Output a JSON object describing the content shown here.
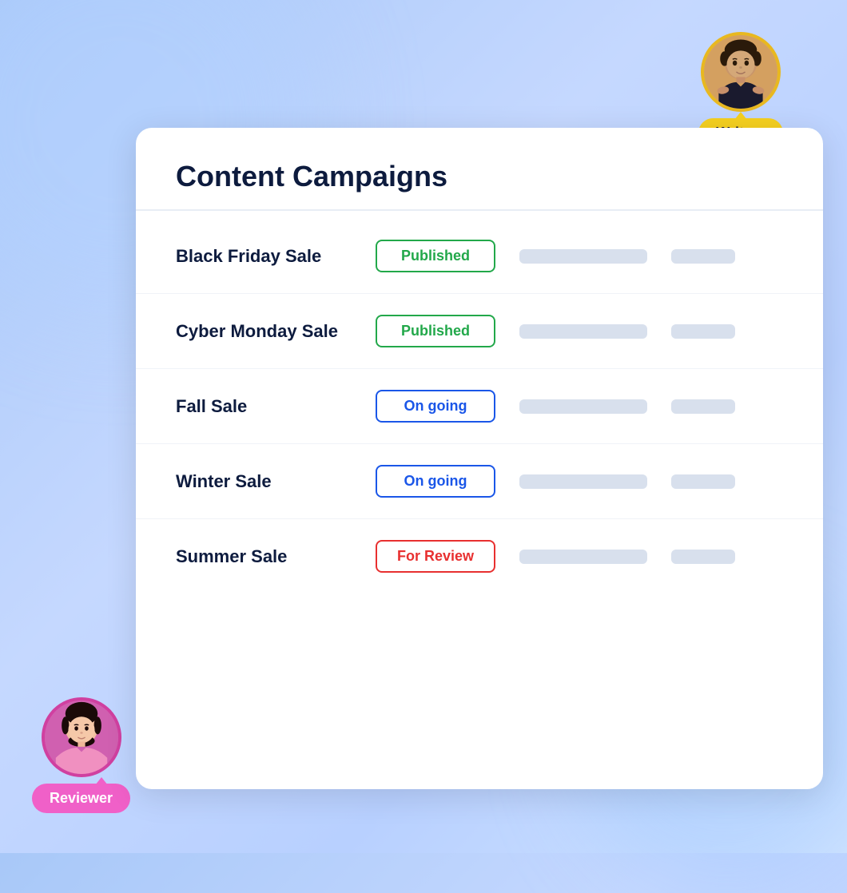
{
  "page": {
    "background": "light blue gradient"
  },
  "writers_badge": {
    "label": "Writers"
  },
  "reviewer_badge": {
    "label": "Reviewer"
  },
  "card": {
    "title": "Content Campaigns",
    "campaigns": [
      {
        "id": 1,
        "name": "Black Friday Sale",
        "status": "Published",
        "status_type": "published"
      },
      {
        "id": 2,
        "name": "Cyber Monday Sale",
        "status": "Published",
        "status_type": "published"
      },
      {
        "id": 3,
        "name": "Fall Sale",
        "status": "On going",
        "status_type": "ongoing"
      },
      {
        "id": 4,
        "name": "Winter Sale",
        "status": "On going",
        "status_type": "ongoing"
      },
      {
        "id": 5,
        "name": "Summer Sale",
        "status": "For Review",
        "status_type": "review"
      }
    ]
  }
}
